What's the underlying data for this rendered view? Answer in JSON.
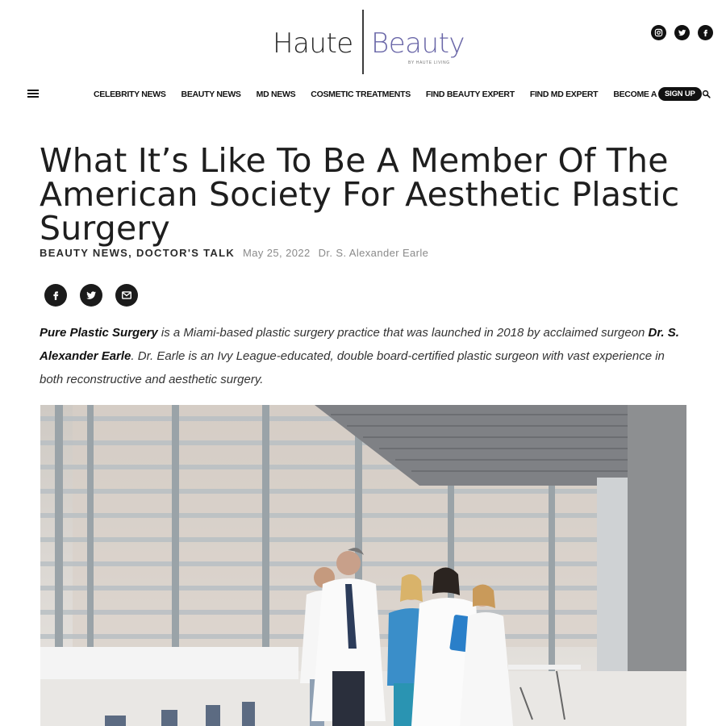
{
  "logo": {
    "part1": "Haute",
    "part2": "Beauty",
    "sub": "BY HAUTE LIVING"
  },
  "social_top": [
    "instagram-icon",
    "twitter-icon",
    "facebook-icon"
  ],
  "nav": {
    "items": [
      "CELEBRITY NEWS",
      "BEAUTY NEWS",
      "MD NEWS",
      "COSMETIC TREATMENTS",
      "FIND BEAUTY EXPERT",
      "FIND MD EXPERT",
      "BECOME A MEMBER"
    ],
    "signup": "SIGN UP"
  },
  "article": {
    "title": "What It’s Like To Be A Member Of The American Society For Aesthetic Plastic Surgery",
    "categories": "BEAUTY NEWS, DOCTOR'S TALK",
    "date": "May 25, 2022",
    "author": "Dr. S. Alexander Earle",
    "intro": {
      "p1_bold": "Pure Plastic Surgery",
      "p1_text": " is a Miami-based plastic surgery practice that was launched in 2018 by acclaimed surgeon ",
      "p2_bold": "Dr. S. Alexander Earle",
      "p2_text": ". Dr. Earle is an Ivy League-educated, double board-certified plastic surgeon with vast experience in both reconstructive and aesthetic surgery."
    }
  },
  "share": [
    "facebook-icon",
    "twitter-icon",
    "email-icon"
  ],
  "colors": {
    "brand_purple": "#6a67a8",
    "dark": "#111111"
  }
}
